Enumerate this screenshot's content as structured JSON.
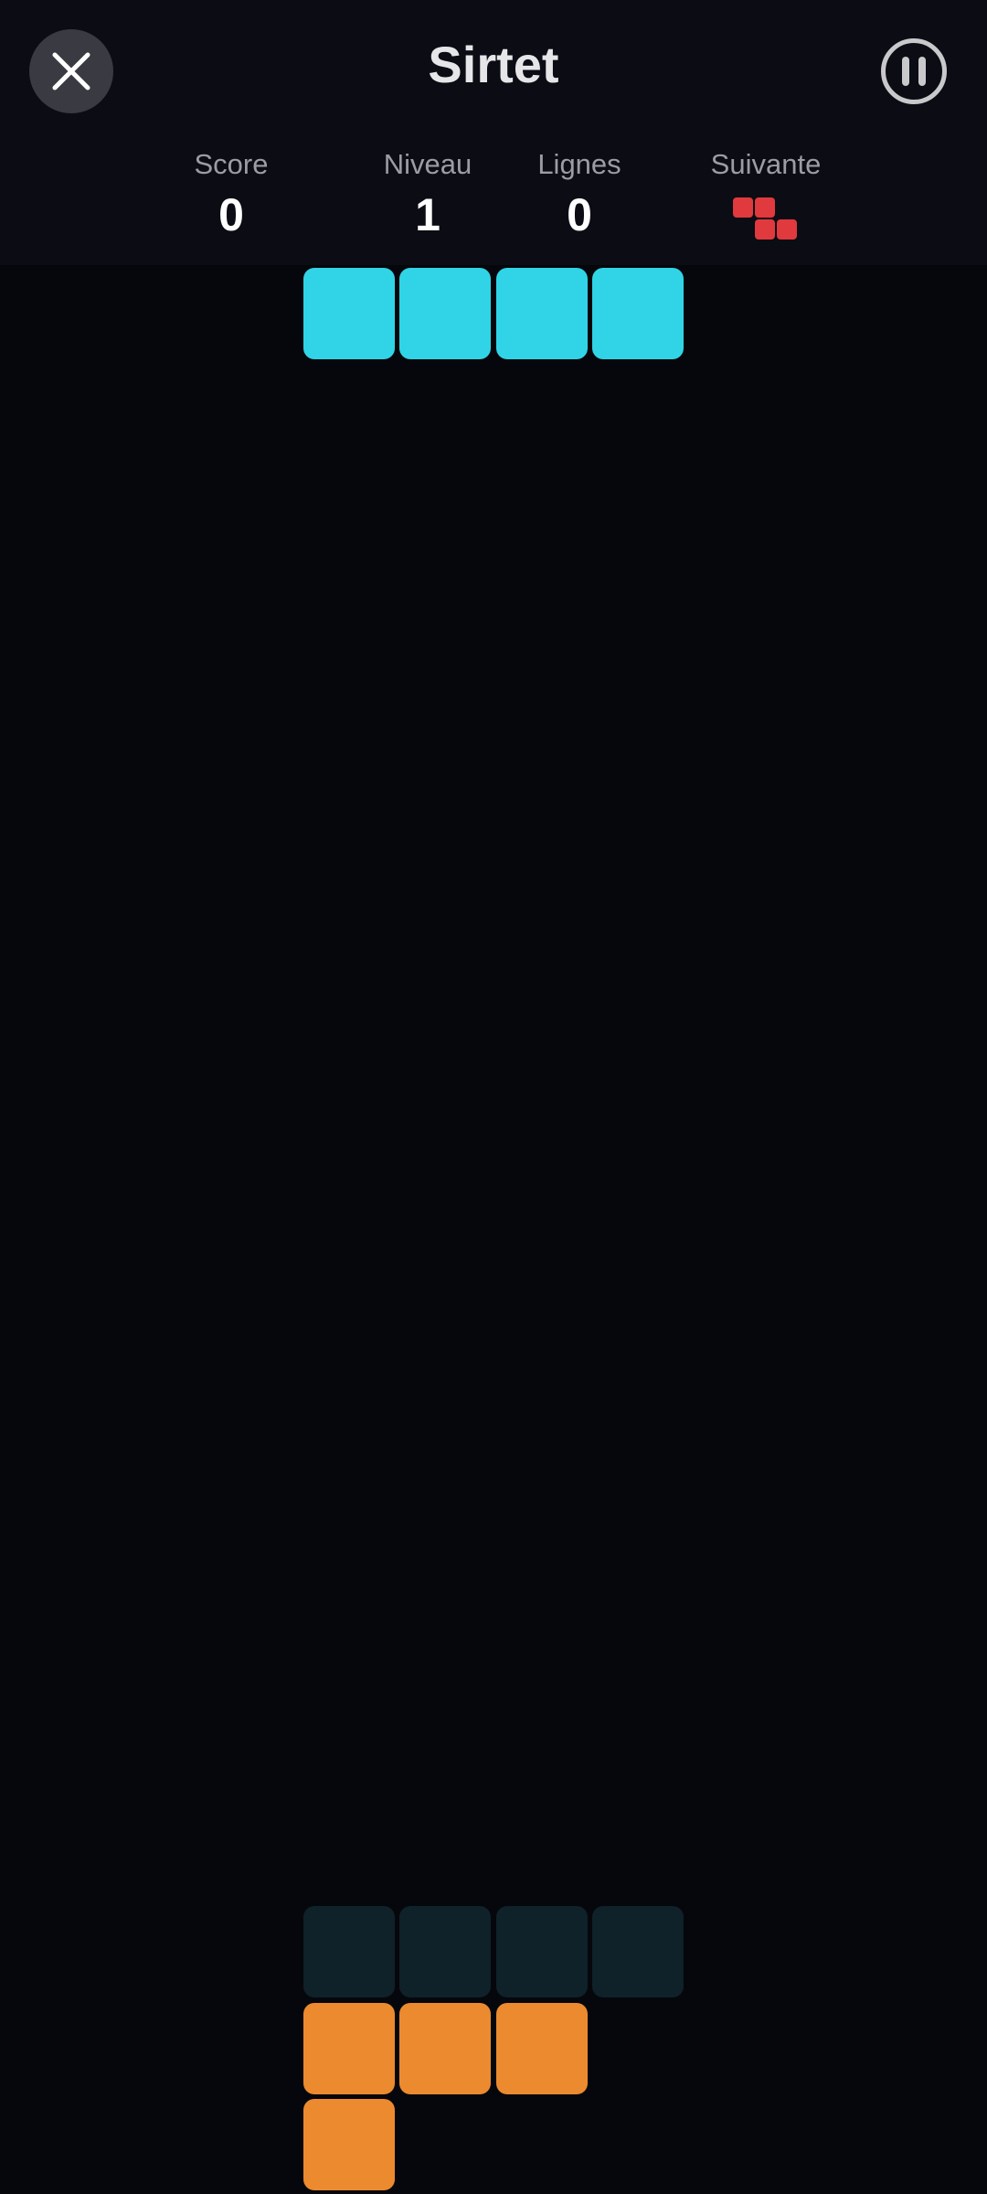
{
  "header": {
    "title": "Sirtet",
    "close_icon": "close-icon",
    "pause_icon": "pause-icon"
  },
  "stats": {
    "score": {
      "label": "Score",
      "value": "0"
    },
    "level": {
      "label": "Niveau",
      "value": "1"
    },
    "lines": {
      "label": "Lignes",
      "value": "0"
    },
    "next": {
      "label": "Suivante",
      "piece": "Z",
      "color": "#e0393e"
    }
  },
  "colors": {
    "active_piece": "#30d4e6",
    "ghost_piece": "#0f2129",
    "locked_piece": "#ec8a2f",
    "background": "#06070c",
    "header": "#0b0c14"
  }
}
